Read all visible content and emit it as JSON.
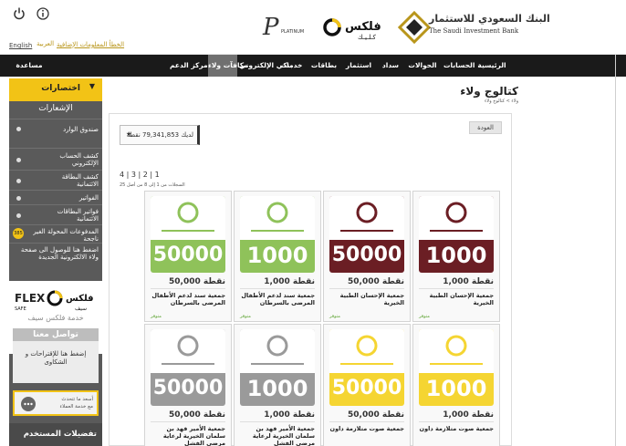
{
  "header": {
    "lang_en": "English",
    "lang_ar": "العربية",
    "trouble_link": "الخطأ المعلومات الإضافية",
    "platinum_label": "PLATINUM",
    "flex_ar": "فلكس",
    "flex_ar_sub": "كـلـيـك",
    "bank_name_ar": "البنك السعودي للاستثمار",
    "bank_name_en": "The Saudi Investment Bank"
  },
  "nav": {
    "items": [
      {
        "label": "الرئيسية"
      },
      {
        "label": "الحسابات"
      },
      {
        "label": "الحوالات"
      },
      {
        "label": "سداد"
      },
      {
        "label": "استثمار"
      },
      {
        "label": "بطاقات"
      },
      {
        "label": "خدمات"
      },
      {
        "label": "بنكي الإلكتروني"
      },
      {
        "label": "مكافآت ولاء"
      },
      {
        "label": "مركز الدعم"
      },
      {
        "label": "مساعدة"
      }
    ]
  },
  "sidebar": {
    "shortcuts_label": "اختصارات",
    "notifications_title": "الإشعارات",
    "items": [
      {
        "label": "صندوق الوارد"
      },
      {
        "label": "كشف الحساب الإلكتروني"
      },
      {
        "label": "كشف البطاقة الائتمانية"
      },
      {
        "label": "الفواتير"
      },
      {
        "label": "فواتير البطاقات الائتمانية"
      },
      {
        "label": "المدفوعات المحولة الغير ناجحة"
      },
      {
        "label": "اضغط هنا للوصول الى صفحة ولاء الالكترونية الجديدة"
      }
    ],
    "badge": "385",
    "flex_safe_en": "FLEX",
    "flex_safe_sub": "SAFE",
    "flex_safe_ar": "فلكس",
    "flex_safe_ar_sub": "سيف",
    "safe_service": "خدمة فلكس سيف",
    "contact_title": "تواصل معنا",
    "contact_text": "إضغط هنا للإقتراحات و الشكاوى",
    "chat_line1": "أسعد ما تتحدث",
    "chat_line2": "مع خدمة العملاء",
    "preferences_label": "تفضيلات المستخدم"
  },
  "main": {
    "catalog_title": "كتالوج ولاء",
    "catalog_crumb": "ولاء > كتالوج ولاء",
    "back_button": "العودة",
    "points_text": "لديك 79,341,853 نقطة",
    "pager": "4 | 3 | 2 | 1",
    "pager_info": "السجلات من 1 إلى 8 من أصل 25",
    "cards": [
      {
        "image_number": "1000",
        "points": "1,000 نقطة",
        "name": "جمعية الإحسان الطبية الخيرية",
        "avail": "متوفر",
        "color": "#6b1e24"
      },
      {
        "image_number": "50000",
        "points": "50,000 نقطة",
        "name": "جمعية الإحسان الطبية الخيرية",
        "avail": "متوفر",
        "color": "#6b1e24"
      },
      {
        "image_number": "1000",
        "points": "1,000 نقطة",
        "name": "جمعية سند لدعم الأطفال المرضى بالسرطان",
        "avail": "متوفر",
        "color": "#8fc25a"
      },
      {
        "image_number": "50000",
        "points": "50,000 نقطة",
        "name": "جمعية سند لدعم الأطفال المرضى بالسرطان",
        "avail": "متوفر",
        "color": "#8fc25a"
      },
      {
        "image_number": "1000",
        "points": "1,000 نقطة",
        "name": "جمعية صوت متلازمة داون",
        "avail": "",
        "color": "#f5d532"
      },
      {
        "image_number": "50000",
        "points": "50,000 نقطة",
        "name": "جمعية صوت متلازمة داون",
        "avail": "",
        "color": "#f5d532"
      },
      {
        "image_number": "1000",
        "points": "1,000 نقطة",
        "name": "جمعية الأمير فهد بن سلمان الخيرية لرعاية مرضى الفشل",
        "avail": "",
        "color": "#9a9a9a"
      },
      {
        "image_number": "50000",
        "points": "50,000 نقطة",
        "name": "جمعية الأمير فهد بن سلمان الخيرية لرعاية مرضى الفشل",
        "avail": "",
        "color": "#9a9a9a"
      }
    ],
    "card_sub_sound": "جمعية صوت متلازمة داون"
  },
  "colors": {
    "nav_bg": "#1a1a1a",
    "accent": "#f2c316",
    "sidebar_bg": "#5a5a5a",
    "gold": "#b9961b"
  },
  "icons": [
    "power-icon",
    "info-icon",
    "chevron-down-icon",
    "chat-icon",
    "star-icon"
  ]
}
